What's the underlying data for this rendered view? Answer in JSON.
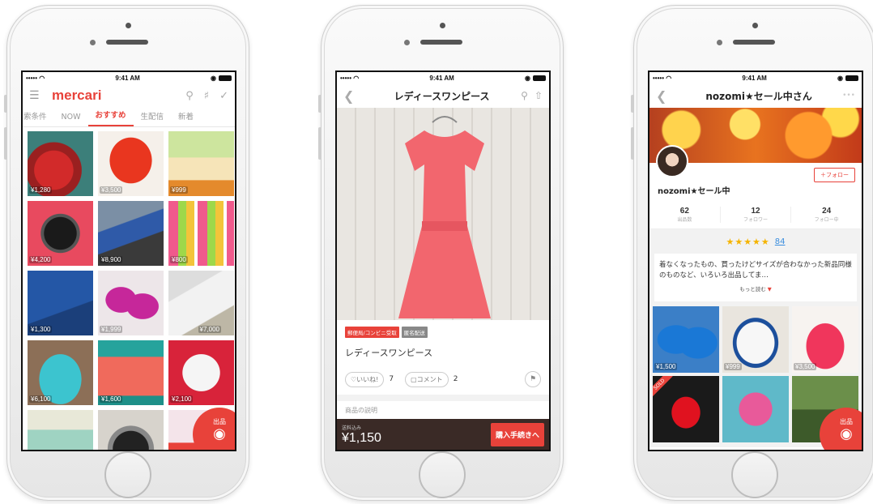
{
  "status_bar": {
    "signal": "••••• ◠",
    "time": "9:41 AM",
    "right": "◉"
  },
  "home": {
    "logo": "mercari",
    "tabs": [
      "索条件",
      "NOW",
      "おすすめ",
      "生配信",
      "新着"
    ],
    "active_tab": 2,
    "items": [
      {
        "price": "¥1,280"
      },
      {
        "price": "¥3,500"
      },
      {
        "price": "¥999"
      },
      {
        "price": "¥4,200"
      },
      {
        "price": "¥8,900"
      },
      {
        "price": "¥800"
      },
      {
        "price": "¥1,300"
      },
      {
        "price": "¥1,999"
      },
      {
        "price": "¥7,000"
      },
      {
        "price": "¥6,100"
      },
      {
        "price": "¥1,600"
      },
      {
        "price": "¥2,100"
      },
      {
        "price": ""
      },
      {
        "price": ""
      },
      {
        "price": ""
      }
    ],
    "sell_label": "出品",
    "icons": [
      "menu-icon",
      "search-icon",
      "bell-icon",
      "check-icon",
      "camera-icon"
    ]
  },
  "product": {
    "title": "レディースワンピース",
    "badges": [
      "郵便局/コンビニ受取",
      "匿名配送"
    ],
    "item_name": "レディースワンピース",
    "like_label": "♡いいね!",
    "like_count": "7",
    "comment_label": "▢コメント",
    "comment_count": "2",
    "description_label": "商品の説明",
    "shipping_note": "送料込み",
    "price": "¥1,150",
    "buy_label": "購入手続きへ"
  },
  "profile": {
    "title": "nozomi★セール中さん",
    "more": "•••",
    "follow_label": "＋フォロー",
    "username": "nozomi★セール中",
    "stats": [
      {
        "num": "62",
        "label": "出品数"
      },
      {
        "num": "12",
        "label": "フォロワー"
      },
      {
        "num": "24",
        "label": "フォロー中"
      }
    ],
    "rating_stars": "★★★★★",
    "rating_count": "84",
    "bio": "着なくなったもの、買ったけどサイズが合わなかった新品同様のものなど、いろいろ出品してま…",
    "read_more": "もっと読む",
    "items": [
      {
        "price": "¥1,500"
      },
      {
        "price": "¥999"
      },
      {
        "price": "¥3,500"
      },
      {
        "price": "",
        "sold": "SOLD"
      },
      {
        "price": ""
      },
      {
        "price": ""
      }
    ],
    "sell_label": "出品"
  },
  "colors": {
    "accent": "#e8423a",
    "link": "#3b8ede",
    "star": "#f5b400"
  }
}
